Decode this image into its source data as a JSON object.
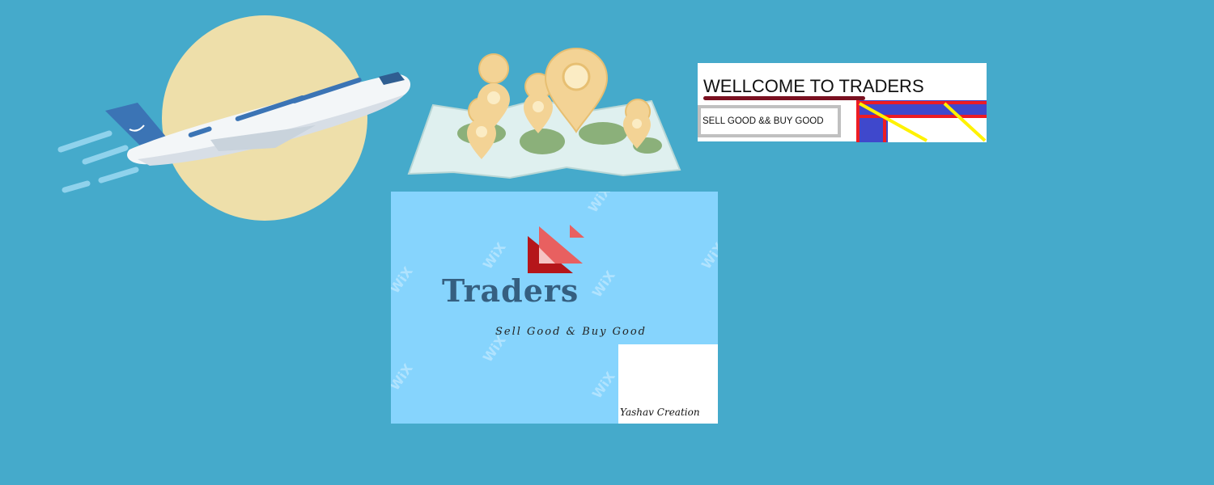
{
  "welcome": {
    "title": "WELLCOME TO TRADERS",
    "tagline": "SELL GOOD  &&  BUY GOOD"
  },
  "logo": {
    "brand_name": "Traders",
    "tagline": "Sell Good & Buy Good",
    "credit": "Yashav Creation",
    "watermark": "WiX"
  },
  "colors": {
    "background": "#45aacb",
    "logo_card": "#86d4fd",
    "brand_text": "#355f80",
    "logo_red": "#c0171a",
    "logo_coral": "#e86060"
  }
}
